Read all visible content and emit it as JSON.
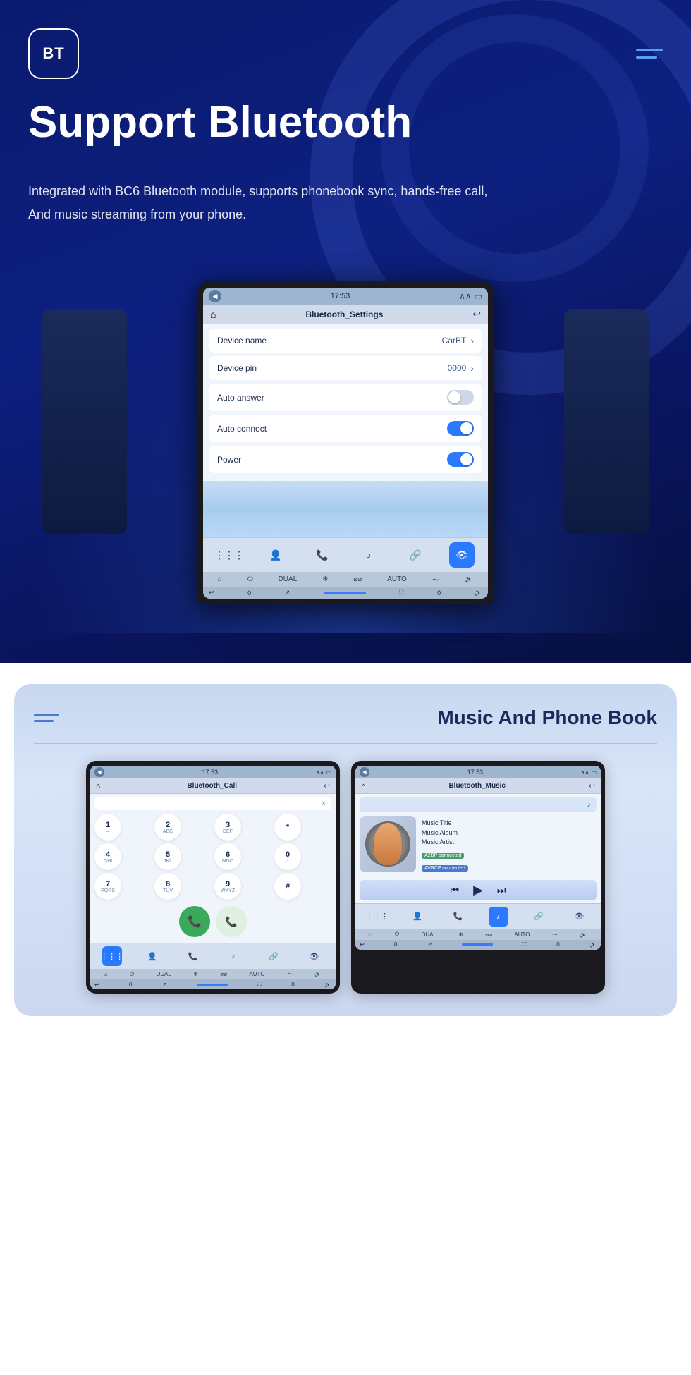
{
  "hero": {
    "logo": "BT",
    "title": "Support Bluetooth",
    "description_line1": "Integrated with BC6 Bluetooth module, supports phonebook sync, hands-free call,",
    "description_line2": "And music streaming from your phone."
  },
  "screen": {
    "status_time": "17:53",
    "nav_title": "Bluetooth_Settings",
    "device_name_label": "Device name",
    "device_name_value": "CarBT",
    "device_pin_label": "Device pin",
    "device_pin_value": "0000",
    "auto_answer_label": "Auto answer",
    "auto_answer_state": "off",
    "auto_connect_label": "Auto connect",
    "auto_connect_state": "on",
    "power_label": "Power",
    "power_state": "on"
  },
  "music_section": {
    "section_title": "Music And Phone Book",
    "call_screen": {
      "status_time": "17:53",
      "nav_title": "Bluetooth_Call",
      "keys": [
        {
          "label": "1",
          "sub": "–"
        },
        {
          "label": "2",
          "sub": "ABC"
        },
        {
          "label": "3",
          "sub": "DEF"
        },
        {
          "label": "*",
          "sub": ""
        },
        {
          "label": "4",
          "sub": "GHI"
        },
        {
          "label": "5",
          "sub": "JKL"
        },
        {
          "label": "6",
          "sub": "MNO"
        },
        {
          "label": "0",
          "sub": "-"
        },
        {
          "label": "7",
          "sub": "PQRS"
        },
        {
          "label": "8",
          "sub": "TUV"
        },
        {
          "label": "9",
          "sub": "WXYZ"
        },
        {
          "label": "#",
          "sub": ""
        }
      ]
    },
    "music_screen": {
      "status_time": "17:53",
      "nav_title": "Bluetooth_Music",
      "music_title": "Music Title",
      "music_album": "Music Album",
      "music_artist": "Music Artist",
      "badge_a2dp": "A2DP connected",
      "badge_avrcp": "AVRCP connected"
    }
  }
}
